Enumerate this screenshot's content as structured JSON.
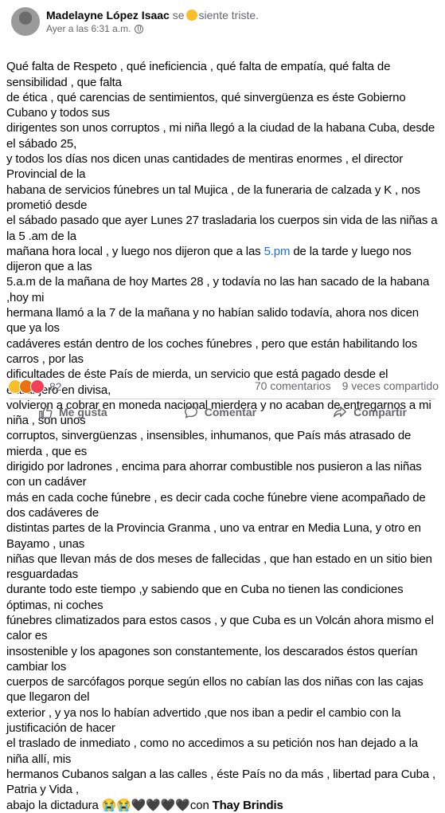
{
  "author": {
    "name": "Madelayne López Isaac",
    "feeling_prefix": "se",
    "feeling": "siente triste.",
    "timestamp": "Ayer a las 6:31 a.m.",
    "emoji_icon": "sad-face-emoji",
    "privacy_icon": "globe-icon"
  },
  "post": {
    "segments": [
      {
        "type": "text",
        "value": "Qué falta de Respeto , qué ineficiencia , qué falta de empatía, qué falta de sensibilidad , que falta\nde ética , qué  carencias de sentimientos, qué sinvergüenza es éste Gobierno Cubano y todos sus\ndirigentes son unos  corruptos , mi niña llegó a la ciudad de la habana Cuba, desde el sábado 25,\ny todos los días nos dicen unas cantidades de mentiras enormes , el director Provincial de la\nhabana de servicios fúnebres un tal Mujica , de la funeraria de calzada y K ,  nos prometió desde\nel sábado pasado que ayer Lunes 27  trasladaria los cuerpos sin vida de las niñas a la 5 .am de la\nmañana hora local , y luego nos dijeron que a las "
      },
      {
        "type": "link",
        "value": "5.pm"
      },
      {
        "type": "text",
        "value": " de la tarde y luego nos dijeron que a las\n5.a.m de la mañana de  hoy Martes 28 , y todavía no las han sacado de la habana  ,hoy mi\nhermana llamó a la 7 de la mañana y no habían salido todavía, ahora nos dicen que ya los\ncadáveres  están dentro de  los coches fúnebres , pero  que  están habilitando los carros , por las\ndificultades de éste País de mierda, un servicio que está pagado desde el extranjero en divisa,\nvolvieron a cobrar en moneda nacional mierdera y no acaban de entregarnos a mi niña , son unos\ncorruptos, sinvergüenzas , insensibles, inhumanos, que País más atrasado de mierda , que es\ndirigido por ladrones , encima para ahorrar combustible nos pusieron a las niñas con un cadáver\nmás en cada coche fúnebre , es decir cada coche fúnebre viene acompañado de dos cadáveres de\ndistintas partes de la Provincia Granma , uno va entrar en Media Luna, y otro en Bayamo , unas\nniñas que llevan más de dos meses de fallecidas , que han estado en un sitio bien resguardadas\ndurante todo este tiempo ,y sabiendo que en Cuba no tienen las  condiciones óptimas, ni coches\nfúnebres climatizados para estos casos , y que Cuba es un Volcán ahora mismo el calor es\ninsostenible y los apagones son constantemente, los descarados éstos querían cambiar los\ncuerpos de sarcófagos porque según ellos no cabían las dos niñas con las cajas que llegaron del\nexterior , y ya nos lo habían advertido ,que nos iban a pedir el cambio con la justificación de hacer\nel traslado de inmediato , como no accedimos a su petición nos han dejado a la niña allí, mis\nhermanos Cubanos salgan a las calles , éste País no da más , libertad para Cuba , Patria y Vida ,\nabajo la dictadura 😭😭🖤🖤🖤🖤con "
      },
      {
        "type": "link",
        "value": "Thay Brindis"
      }
    ]
  },
  "reactions": {
    "icons": [
      "sad-reaction-icon",
      "angry-reaction-icon",
      "love-reaction-icon"
    ],
    "count": "82",
    "comments": "70 comentarios",
    "shares": "9 veces compartido"
  },
  "actions": {
    "like": "Me gusta",
    "comment": "Comentar",
    "share": "Compartir"
  }
}
